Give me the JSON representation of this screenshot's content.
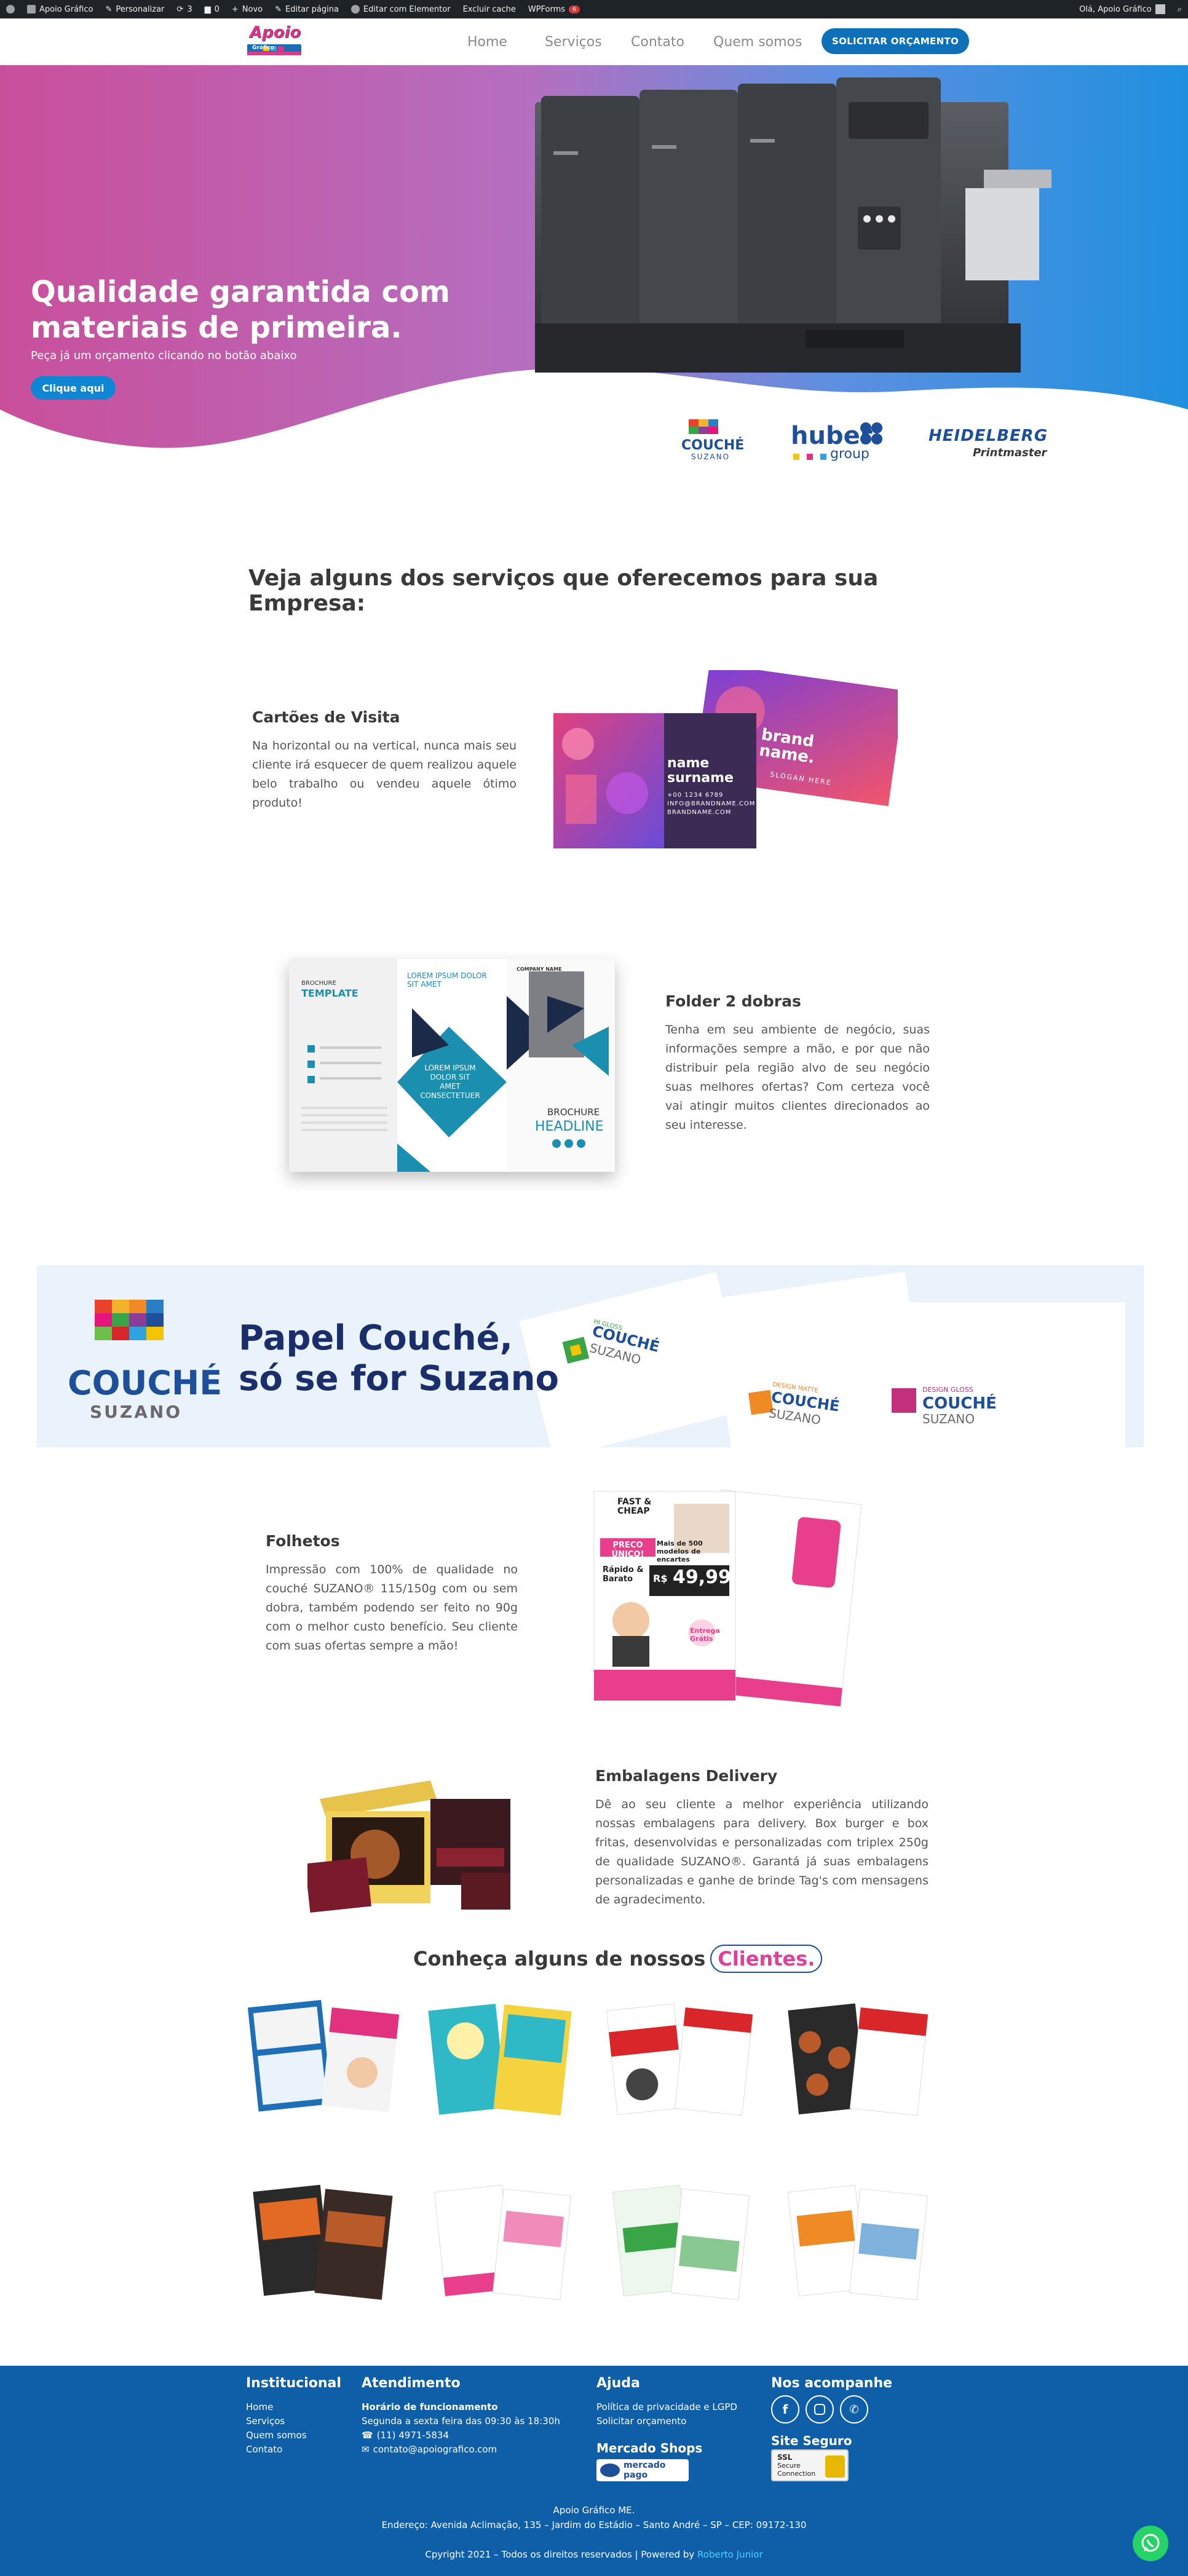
{
  "admin_bar": {
    "items": [
      "Apoio Gráfico",
      "Personalizar",
      "3",
      "0",
      "Novo",
      "Editar página",
      "Editar com Elementor",
      "Excluir cache",
      "WPForms"
    ],
    "wpforms_badge": "6",
    "greeting": "Olá, Apoio Gráfico"
  },
  "header": {
    "logo_text": "Apoio",
    "logo_sub": "Gráfico",
    "nav": [
      "Home",
      "Serviços",
      "Contato",
      "Quem somos"
    ],
    "cta": "SOLICITAR ORÇAMENTO"
  },
  "hero": {
    "title": "Qualidade garantida com materiais de primeira.",
    "subtitle": "Peça já um orçamento clicando no botão abaixo",
    "button": "Clique aqui",
    "partners": {
      "couche": "COUCHÉ",
      "couche_sub": "SUZANO",
      "huber": "huber",
      "huber_sub": "group",
      "heidelberg": "HEIDELBERG",
      "heidelberg_sub": "Printmaster"
    }
  },
  "services": {
    "heading": "Veja alguns dos serviços que oferecemos para sua Empresa:",
    "items": [
      {
        "title": "Cartões de Visita",
        "text": "Na horizontal ou na vertical, nunca mais seu cliente irá esquecer de quem realizou aquele belo trabalho ou vendeu aquele ótimo produto!"
      },
      {
        "title": "Folder 2 dobras",
        "text": "Tenha em seu ambiente de negócio, suas informações sempre a mão, e por que não distribuir pela região alvo de seu negócio suas melhores ofertas? Com certeza você vai atingir muitos clientes direcionados ao seu interesse."
      },
      {
        "title": "Folhetos",
        "text": "Impressão com 100% de qualidade no couché SUZANO® 115/150g com ou sem dobra, também podendo ser feito no 90g com o melhor custo benefício. Seu cliente com suas ofertas sempre a mão!"
      },
      {
        "title": "Embalagens Delivery",
        "text": "Dê ao seu cliente a melhor experiência utilizando nossas embalagens para delivery. Box burger e box fritas, desenvolvidas e personalizadas com triplex 250g de qualidade SUZANO®. Garantá já suas embalagens personalizadas e ganhe de brinde Tag's com mensagens de agradecimento."
      }
    ],
    "card_front": {
      "name": "name surname",
      "lines": [
        "+00 1234 6789",
        "INFO@BRANDNAME.COM",
        "BRANDNAME.COM"
      ]
    },
    "card_back": {
      "name": "brand name.",
      "slogan": "SLOGAN HERE"
    },
    "brochure": {
      "label": "BROCHURE",
      "template": "TEMPLATE",
      "lorem": "LOREM IPSUM DOLOR SIT AMET",
      "lorem_center": "LOREM IPSUM DOLOR SIT AMET CONSECTETUER",
      "brochure_b": "BROCHURE",
      "headline": "HEADLINE",
      "company": "COMPANY NAME"
    }
  },
  "banner": {
    "brand": "COUCHÉ",
    "brand_sub": "SUZANO",
    "headline_1": "Papel Couché,",
    "headline_2": "só se for Suzano",
    "sheets": [
      {
        "top": "HI GLOSS",
        "name": "COUCHÉ",
        "sub": "SUZANO"
      },
      {
        "top": "DESIGN MATTE",
        "name": "COUCHÉ",
        "sub": "SUZANO"
      },
      {
        "top": "DESIGN GLOSS",
        "name": "COUCHÉ",
        "sub": "SUZANO"
      }
    ]
  },
  "flyer": {
    "brand": "FAST & CHEAP",
    "unico": "PRECO ÚNICO!",
    "models": "Mais de 500 modelos de encartes",
    "fast": "Rápido & Barato",
    "price_prefix": "R$",
    "price": "49,99",
    "delivery": "Entrega Grátis"
  },
  "clients": {
    "heading": "Conheça alguns de nossos",
    "highlight": "Clientes."
  },
  "footer": {
    "col1_title": "Institucional",
    "col1_links": [
      "Home",
      "Serviços",
      "Quem somos",
      "Contato"
    ],
    "col2_title": "Atendimento",
    "hours_title": "Horário de funcionamento",
    "hours": "Segunda a sexta feira das 09:30 às 18:30h",
    "phone": "(11) 4971-5834",
    "email": "contato@apoiografico.com",
    "col3_title": "Ajuda",
    "col3_links": [
      "Política de privacidade e LGPD",
      "Solicitar orçamento"
    ],
    "mercado_title": "Mercado Shops",
    "mercado_badge": "mercado pago",
    "col4_title": "Nos acompanhe",
    "site_seguro": "Site Seguro",
    "ssl": [
      "SSL",
      "Secure",
      "Connection"
    ],
    "company": "Apoio Gráfico ME.",
    "address": "Endereço: Avenida Aclimação, 135 – Jardim do Estádio – Santo André – SP – CEP: 09172-130",
    "copyright": "Cpyright 2021 – Todos os direitos reservados | Powered by ",
    "powered_by": "Roberto Junior"
  },
  "colors": {
    "pink": "#c94f9b",
    "blue": "#1e90df",
    "footer": "#0f5fa8",
    "button": "#0e70b9",
    "highlight": "#e0409a"
  }
}
